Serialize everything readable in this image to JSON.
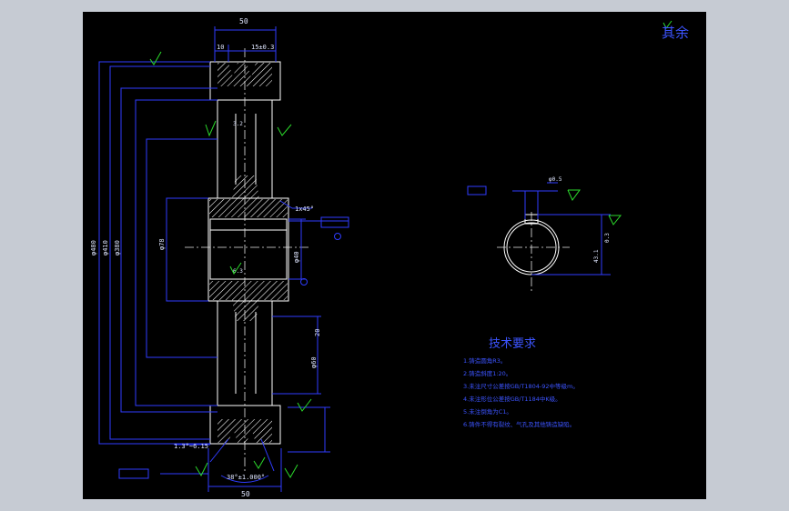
{
  "drawing": {
    "corner_note": "其余",
    "tech_title": "技术要求",
    "tech_items": [
      "1.铸造圆角R3。",
      "2.铸造斜度1:20。",
      "3.未注尺寸公差按GB/T1804-92中等级m。",
      "4.未注形位公差按GB/T1184中K级。",
      "5.未注倒角为C1。",
      "6.铸件不得有裂纹、气孔及其他铸造缺陷。"
    ],
    "dims": {
      "top_width": "50",
      "top_small_a": "10",
      "top_small_b": "15±0.3",
      "bottom_width": "50",
      "vert_1": "φ480",
      "vert_2": "φ410",
      "vert_3": "φ380",
      "vert_4": "φ78",
      "bore": "φ40",
      "side_a": "20",
      "side_b": "φ60",
      "angle_note": "1.3°~6.15",
      "angle_bottom": "38°±1.000°",
      "keyway_width": "φ0.5",
      "key_depth": "43.1",
      "key_side": "0.3",
      "ra_a": "3.2",
      "ra_b": "6.3",
      "callout": "1x45°"
    }
  }
}
